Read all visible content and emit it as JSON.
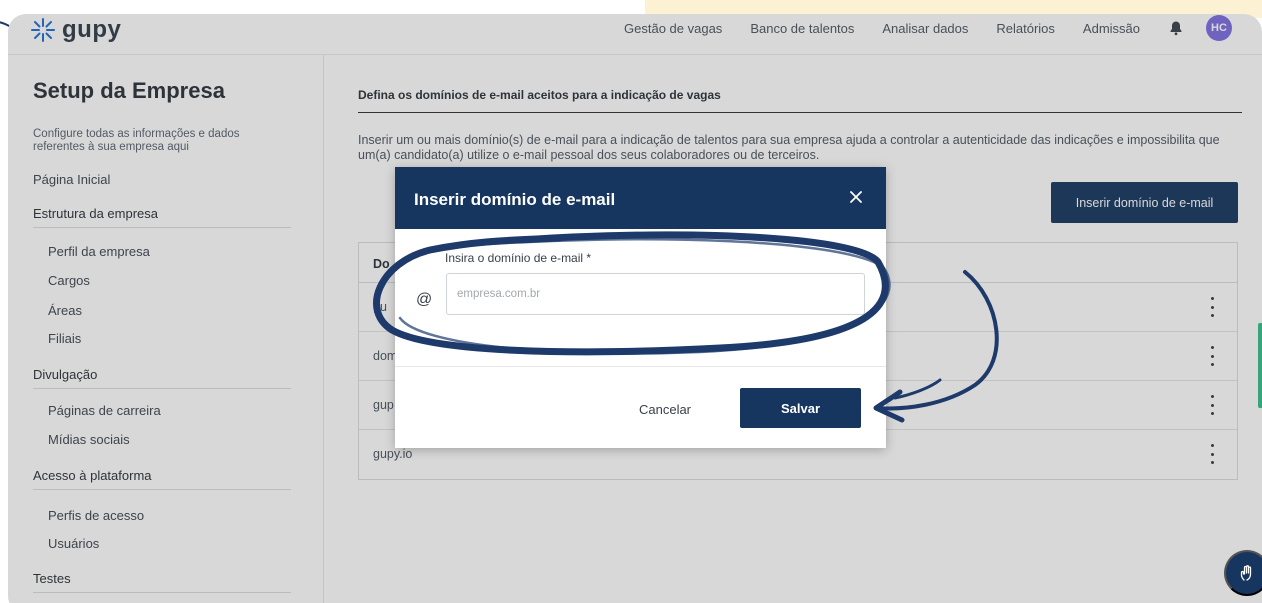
{
  "brand": {
    "name": "gupy",
    "accent": "#16365f",
    "avatar_color": "#7d6de0"
  },
  "nav": {
    "items": [
      "Gestão de vagas",
      "Banco de talentos",
      "Analisar dados",
      "Relatórios",
      "Admissão"
    ],
    "bell_icon": "bell-icon",
    "avatar_initials": "HC"
  },
  "sidebar": {
    "title": "Setup da Empresa",
    "description": "Configure todas as informações e dados referentes à sua empresa aqui",
    "home_link": "Página Inicial",
    "sections": [
      {
        "label": "Estrutura da empresa",
        "items": [
          "Perfil da empresa",
          "Cargos",
          "Áreas",
          "Filiais"
        ]
      },
      {
        "label": "Divulgação",
        "items": [
          "Páginas de carreira",
          "Mídias sociais"
        ]
      },
      {
        "label": "Acesso à plataforma",
        "items": [
          "Perfis de acesso",
          "Usuários"
        ]
      },
      {
        "label": "Testes",
        "items": []
      }
    ]
  },
  "content": {
    "heading": "Defina os domínios de e-mail aceitos para a indicação de vagas",
    "description": "Inserir um ou mais domínio(s) de e-mail para a indicação de talentos para sua empresa ajuda a controlar a autenticidade das indicações e impossibilita que um(a) candidato(a) utilize o e-mail pessoal dos seus colaboradores ou de terceiros.",
    "insert_button": "Inserir domínio de e-mail",
    "table": {
      "header": "Do",
      "rows": [
        "gu",
        "dom",
        "gup",
        "gupy.io"
      ]
    }
  },
  "modal": {
    "title": "Inserir domínio de e-mail",
    "close_icon": "close-icon",
    "field_label": "Insira o domínio de e-mail *",
    "at_symbol": "@",
    "input_value": "",
    "input_placeholder": "empresa.com.br",
    "cancel_label": "Cancelar",
    "save_label": "Salvar"
  }
}
